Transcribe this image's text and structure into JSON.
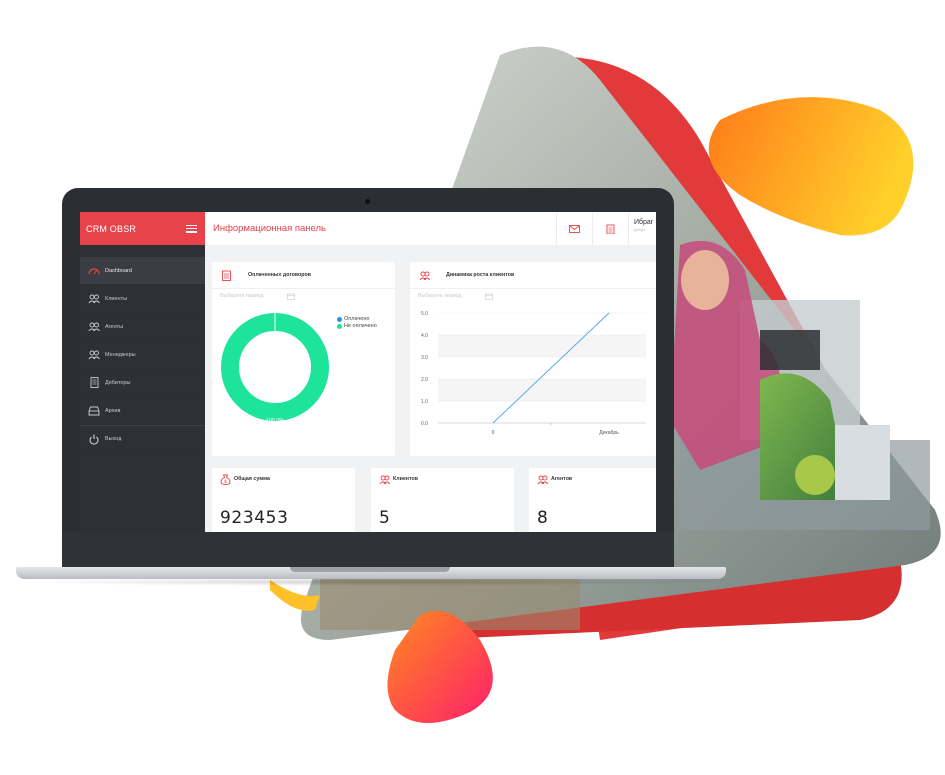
{
  "app": {
    "brand": "CRM OBSR",
    "page_title": "Информационная панель",
    "user": {
      "name": "Ибраг",
      "role": "добро"
    }
  },
  "sidebar": {
    "items": [
      {
        "label": "Dashboard",
        "icon": "gauge-icon",
        "active": true
      },
      {
        "label": "Клиенты",
        "icon": "users-icon"
      },
      {
        "label": "Агенты",
        "icon": "users-icon"
      },
      {
        "label": "Менеджеры",
        "icon": "users-icon"
      },
      {
        "label": "Дебиторы",
        "icon": "document-icon"
      },
      {
        "label": "Архив",
        "icon": "archive-icon"
      },
      {
        "label": "Выход",
        "icon": "power-icon"
      }
    ]
  },
  "header_icons": [
    "mail-icon",
    "clipboard-icon"
  ],
  "cards": {
    "paid_contracts": {
      "title": "Оплаченных договоров",
      "period_placeholder": "Выберите период",
      "legend": [
        {
          "label": "Оплачено",
          "color": "#2e8fe6"
        },
        {
          "label": "Не оплачено",
          "color": "#1ee39b"
        }
      ],
      "slice_label": "100.0%"
    },
    "client_growth": {
      "title": "Динамика роста клиентов",
      "period_placeholder": "Выберите период"
    }
  },
  "stats": [
    {
      "label": "Общая сумма",
      "value": "923453",
      "icon": "money-bag-icon"
    },
    {
      "label": "Клиентов",
      "value": "5",
      "icon": "users-icon"
    },
    {
      "label": "Агентов",
      "value": "8",
      "icon": "users-icon"
    }
  ],
  "colors": {
    "accent": "#e8424a",
    "sidebar": "#2d3035",
    "donut": "#1ee39b",
    "line": "#5aa9f0"
  },
  "chart_data": [
    {
      "type": "pie",
      "categories": [
        "Оплачено",
        "Не оплачено"
      ],
      "values": [
        0,
        100
      ],
      "labels": [
        "100.0%"
      ]
    },
    {
      "type": "line",
      "x": [
        "0",
        "Декабрь"
      ],
      "y_ticks": [
        "0.0",
        "1.0",
        "2.0",
        "3.0",
        "4.0",
        "5.0"
      ],
      "ylim": [
        0,
        5
      ],
      "series": [
        {
          "values": [
            0,
            5
          ]
        }
      ],
      "grid": true
    }
  ]
}
